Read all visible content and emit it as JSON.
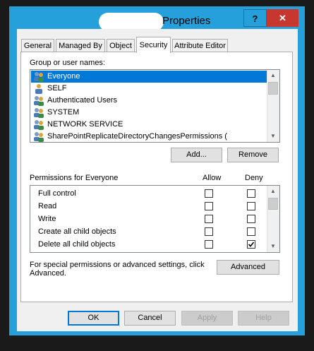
{
  "window": {
    "title": "Properties",
    "help_label": "?",
    "close_label": "✕",
    "close_color": "#c7372f",
    "frame_color": "#26a0da"
  },
  "tabs": [
    {
      "label": "General",
      "active": false
    },
    {
      "label": "Managed By",
      "active": false
    },
    {
      "label": "Object",
      "active": false
    },
    {
      "label": "Security",
      "active": true
    },
    {
      "label": "Attribute Editor",
      "active": false
    }
  ],
  "groups": {
    "label": "Group or user names:",
    "items": [
      {
        "name": "Everyone",
        "selected": true,
        "icon": "users-icon"
      },
      {
        "name": "SELF",
        "selected": false,
        "icon": "user-icon"
      },
      {
        "name": "Authenticated Users",
        "selected": false,
        "icon": "users-icon"
      },
      {
        "name": "SYSTEM",
        "selected": false,
        "icon": "users-icon"
      },
      {
        "name": "NETWORK SERVICE",
        "selected": false,
        "icon": "users-icon"
      },
      {
        "name": "SharePointReplicateDirectoryChangesPermissions (",
        "selected": false,
        "icon": "users-icon"
      }
    ],
    "add_label": "Add...",
    "remove_label": "Remove"
  },
  "permissions": {
    "header": "Permissions for Everyone",
    "allow_label": "Allow",
    "deny_label": "Deny",
    "rows": [
      {
        "name": "Full control",
        "allow": false,
        "deny": false
      },
      {
        "name": "Read",
        "allow": false,
        "deny": false
      },
      {
        "name": "Write",
        "allow": false,
        "deny": false
      },
      {
        "name": "Create all child objects",
        "allow": false,
        "deny": false
      },
      {
        "name": "Delete all child objects",
        "allow": false,
        "deny": true
      }
    ]
  },
  "advanced": {
    "text": "For special permissions or advanced settings, click Advanced.",
    "button_label": "Advanced"
  },
  "footer": {
    "ok_label": "OK",
    "cancel_label": "Cancel",
    "apply_label": "Apply",
    "help_label": "Help"
  }
}
